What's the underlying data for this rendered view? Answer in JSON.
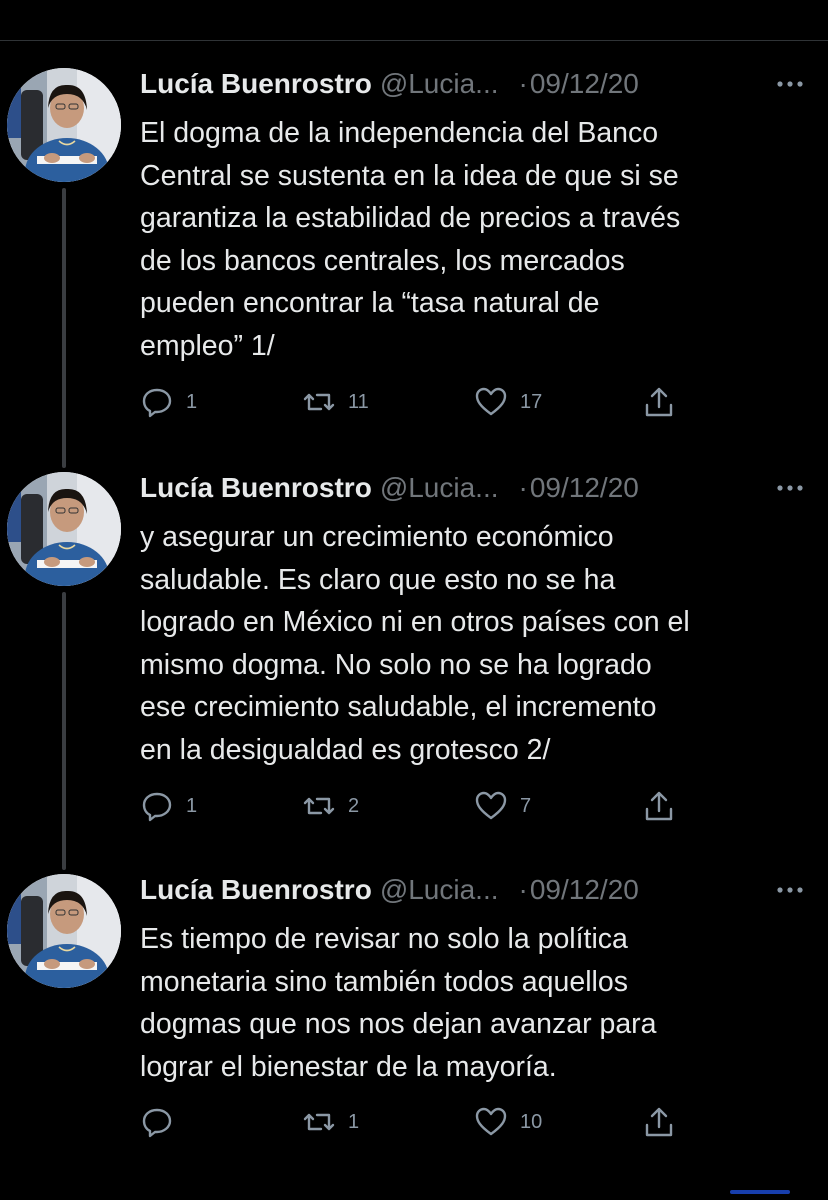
{
  "colors": {
    "background": "#000000",
    "text": "#e7e9ea",
    "muted": "#71767b",
    "icon": "#8b98a5",
    "thread_line": "#3a3d41"
  },
  "tweets": [
    {
      "author_name": "Lucía Buenrostro",
      "handle": "@Lucia...",
      "separator": "·",
      "date": "09/12/20",
      "text": "El dogma de la independencia del Banco\nCentral se sustenta en la idea de que si se\ngarantiza la estabilidad de precios a través\nde los bancos centrales, los mercados\npueden encontrar la “tasa natural de\nempleo” 1/",
      "replies": "1",
      "retweets": "11",
      "likes": "17",
      "icons": [
        "reply-icon",
        "retweet-icon",
        "like-icon",
        "share-icon"
      ]
    },
    {
      "author_name": "Lucía Buenrostro",
      "handle": "@Lucia...",
      "separator": "·",
      "date": "09/12/20",
      "text": "y asegurar un crecimiento económico\nsaludable. Es claro que esto no se ha\nlogrado en México ni en otros países con el\nmismo dogma. No solo no se ha logrado\nese crecimiento saludable, el incremento\nen la desigualdad es grotesco 2/",
      "replies": "1",
      "retweets": "2",
      "likes": "7",
      "icons": [
        "reply-icon",
        "retweet-icon",
        "like-icon",
        "share-icon"
      ]
    },
    {
      "author_name": "Lucía Buenrostro",
      "handle": "@Lucia...",
      "separator": "·",
      "date": "09/12/20",
      "text": "Es tiempo de revisar no solo la política\nmonetaria sino también todos aquellos\ndogmas que nos nos dejan avanzar para\nlograr el bienestar de la mayoría.",
      "replies": "",
      "retweets": "1",
      "likes": "10",
      "icons": [
        "reply-icon",
        "retweet-icon",
        "like-icon",
        "share-icon"
      ]
    }
  ]
}
